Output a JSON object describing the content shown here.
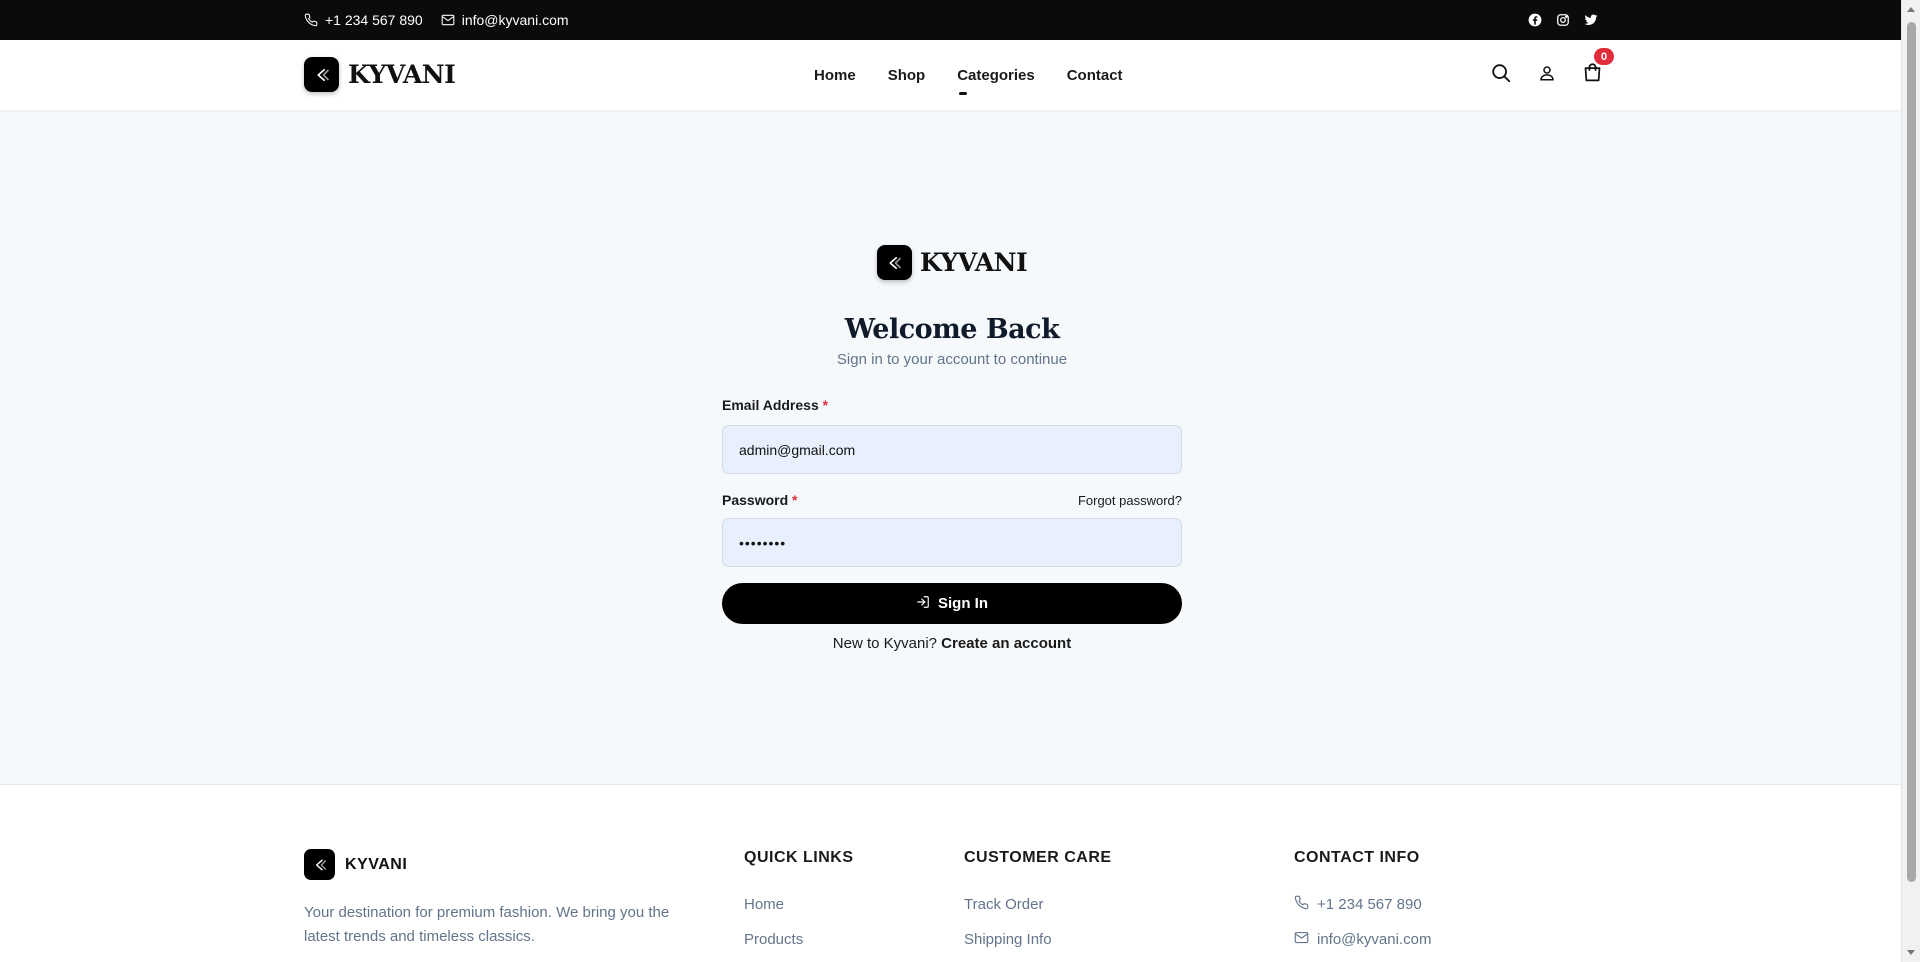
{
  "topbar": {
    "phone": "+1 234 567 890",
    "email": "info@kyvani.com",
    "social_icons": [
      "facebook-icon",
      "instagram-icon",
      "twitter-icon"
    ]
  },
  "header": {
    "brand": "KYVANI",
    "nav": [
      {
        "label": "Home"
      },
      {
        "label": "Shop"
      },
      {
        "label": "Categories"
      },
      {
        "label": "Contact"
      }
    ],
    "cart_count": "0"
  },
  "auth": {
    "brand": "KYVANI",
    "title": "Welcome Back",
    "subtitle": "Sign in to your account to continue",
    "email_label": "Email Address",
    "email_value": "admin@gmail.com",
    "password_label": "Password",
    "password_value": "••••••••",
    "forgot_label": "Forgot password?",
    "required_mark": "*",
    "submit_label": "Sign In",
    "register_prompt": "New to Kyvani?",
    "register_link": "Create an account"
  },
  "footer": {
    "brand": "KYVANI",
    "description": "Your destination for premium fashion. We bring you the latest trends and timeless classics.",
    "quick_links": {
      "title": "QUICK LINKS",
      "items": [
        "Home",
        "Products"
      ]
    },
    "customer_care": {
      "title": "CUSTOMER CARE",
      "items": [
        "Track Order",
        "Shipping Info"
      ]
    },
    "contact": {
      "title": "CONTACT INFO",
      "phone": "+1 234 567 890",
      "email": "info@kyvani.com"
    }
  },
  "colors": {
    "topbar_bg": "#0b0b0b",
    "page_bg": "#f6f9fc",
    "accent": "#000000",
    "badge": "#e02d3c",
    "input_bg": "#e8f0fe"
  }
}
